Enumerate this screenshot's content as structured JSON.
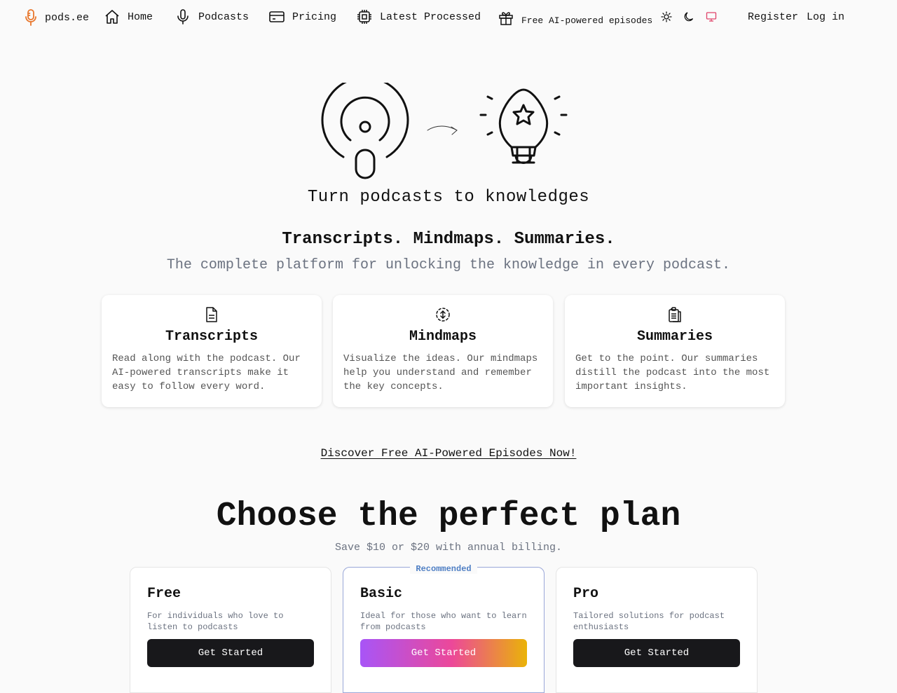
{
  "nav": {
    "brand": "pods.ee",
    "home": "Home",
    "podcasts": "Podcasts",
    "pricing": "Pricing",
    "latest": "Latest Processed",
    "free": "Free AI-powered episodes",
    "register": "Register",
    "login": "Log in"
  },
  "hero": {
    "tagline": "Turn podcasts to knowledges",
    "headline": "Transcripts. Mindmaps. Summaries.",
    "subline": "The complete platform for unlocking the knowledge in every podcast."
  },
  "features": [
    {
      "title": "Transcripts",
      "text": "Read along with the podcast. Our AI-powered transcripts make it easy to follow every word.",
      "icon": "file-text-icon"
    },
    {
      "title": "Mindmaps",
      "text": "Visualize the ideas. Our mindmaps help you understand and remember the key concepts.",
      "icon": "mindmap-icon"
    },
    {
      "title": "Summaries",
      "text": "Get to the point. Our summaries distill the podcast into the most important insights.",
      "icon": "clipboard-icon"
    }
  ],
  "cta": "Discover Free AI-Powered Episodes Now!",
  "pricing": {
    "title": "Choose the perfect plan",
    "subtitle": "Save $10 or $20 with annual billing.",
    "recommended": "Recommended",
    "plans": [
      {
        "name": "Free",
        "desc": "For individuals who love to listen to podcasts",
        "button": "Get Started"
      },
      {
        "name": "Basic",
        "desc": "Ideal for those who want to learn from podcasts",
        "button": "Get Started"
      },
      {
        "name": "Pro",
        "desc": "Tailored solutions for podcast enthusiasts",
        "button": "Get Started"
      }
    ]
  },
  "colors": {
    "brand": "#e8762b",
    "accent": "#4f7fc4",
    "muted": "#6b7280",
    "theme_active": "#e0446a"
  }
}
